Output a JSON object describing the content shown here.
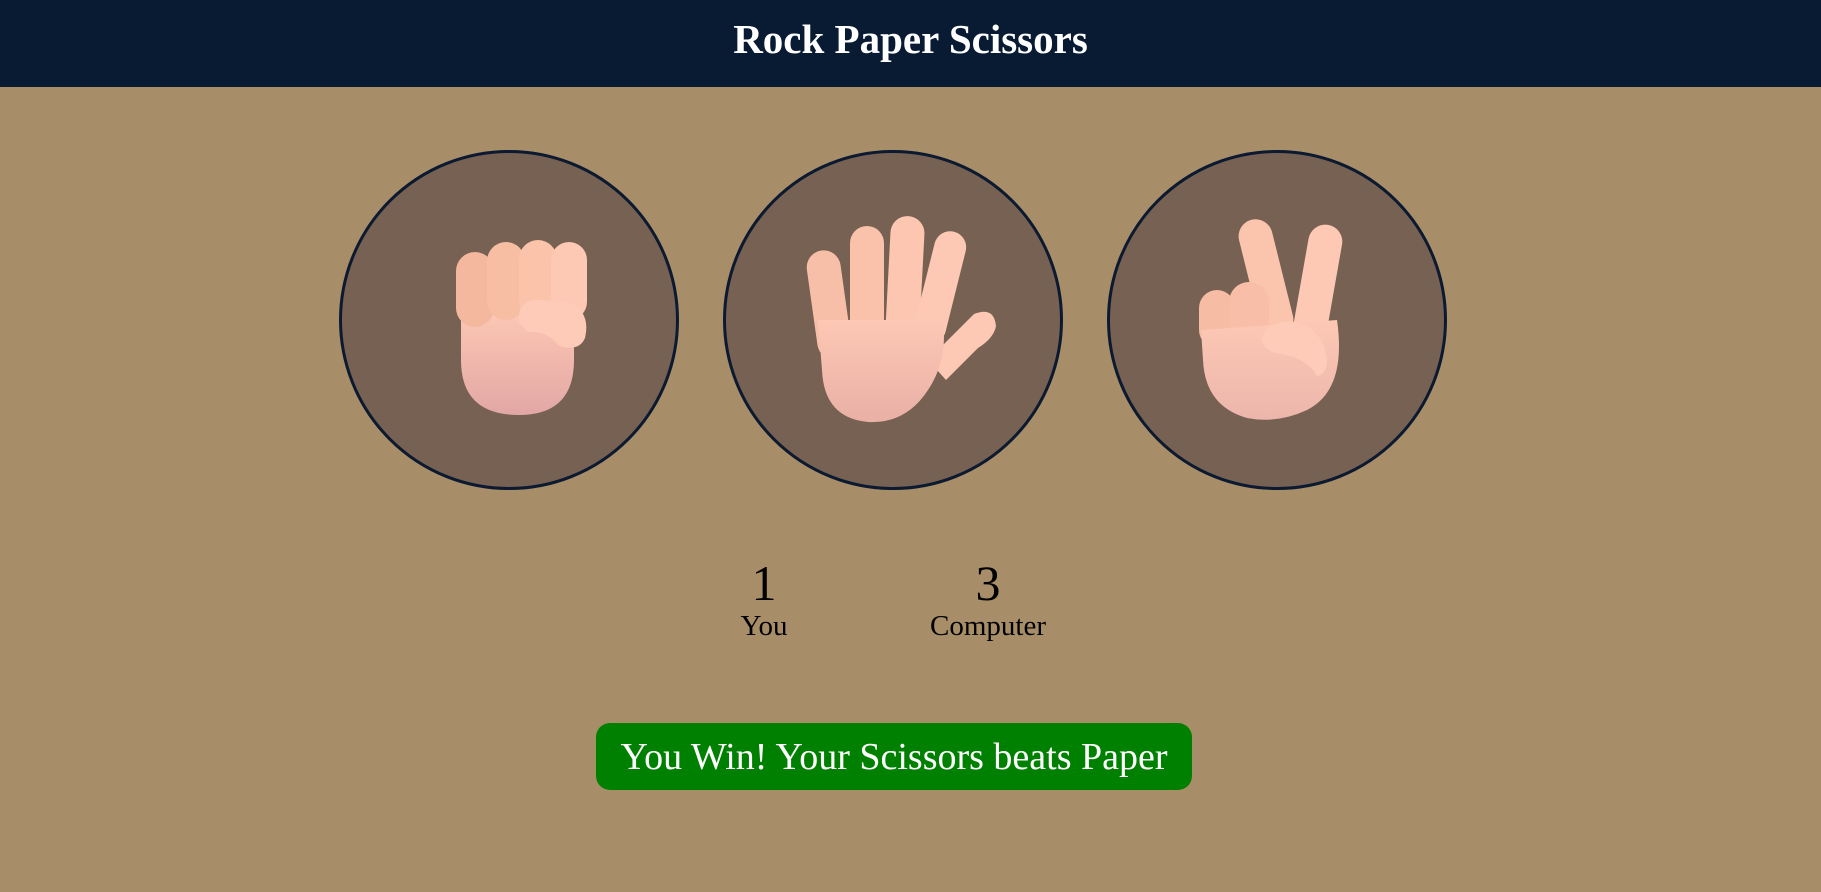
{
  "header": {
    "title": "Rock Paper Scissors"
  },
  "choices": [
    {
      "id": "rock",
      "icon": "fist-hand-icon"
    },
    {
      "id": "paper",
      "icon": "open-hand-icon"
    },
    {
      "id": "scissors",
      "icon": "victory-hand-icon"
    }
  ],
  "scoreboard": {
    "user": {
      "score": "1",
      "label": "You"
    },
    "computer": {
      "score": "3",
      "label": "Computer"
    }
  },
  "result": {
    "message": "You Win! Your Scissors beats Paper",
    "status": "win"
  },
  "colors": {
    "header_bg": "#081b33",
    "page_bg": "#a88e68",
    "circle_bg": "#766152",
    "circle_border": "#0b1a30",
    "result_win_bg": "#008000",
    "skin_light": "#fdc8b4",
    "skin_mid": "#f2b2a0",
    "skin_shadow": "#d89a94"
  }
}
